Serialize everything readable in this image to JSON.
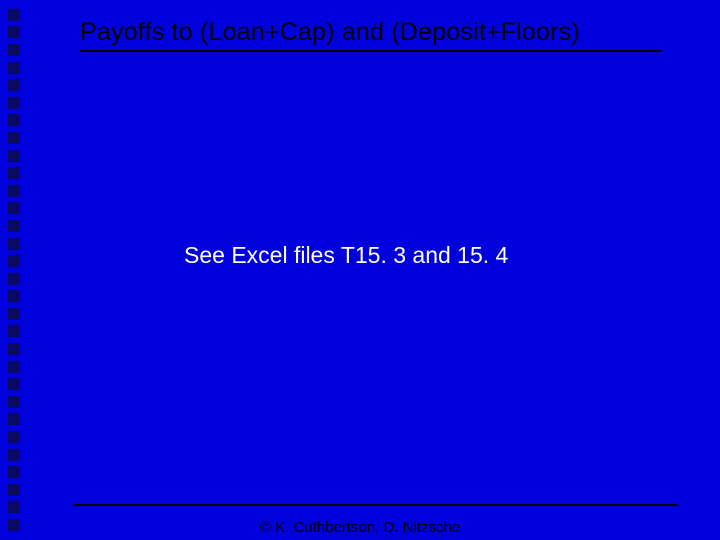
{
  "slide": {
    "title": "Payoffs to (Loan+Cap) and (Deposit+Floors)",
    "body": "See Excel files T15. 3 and 15. 4",
    "footer": "© K. Cuthbertson, D. Nitzsche"
  }
}
